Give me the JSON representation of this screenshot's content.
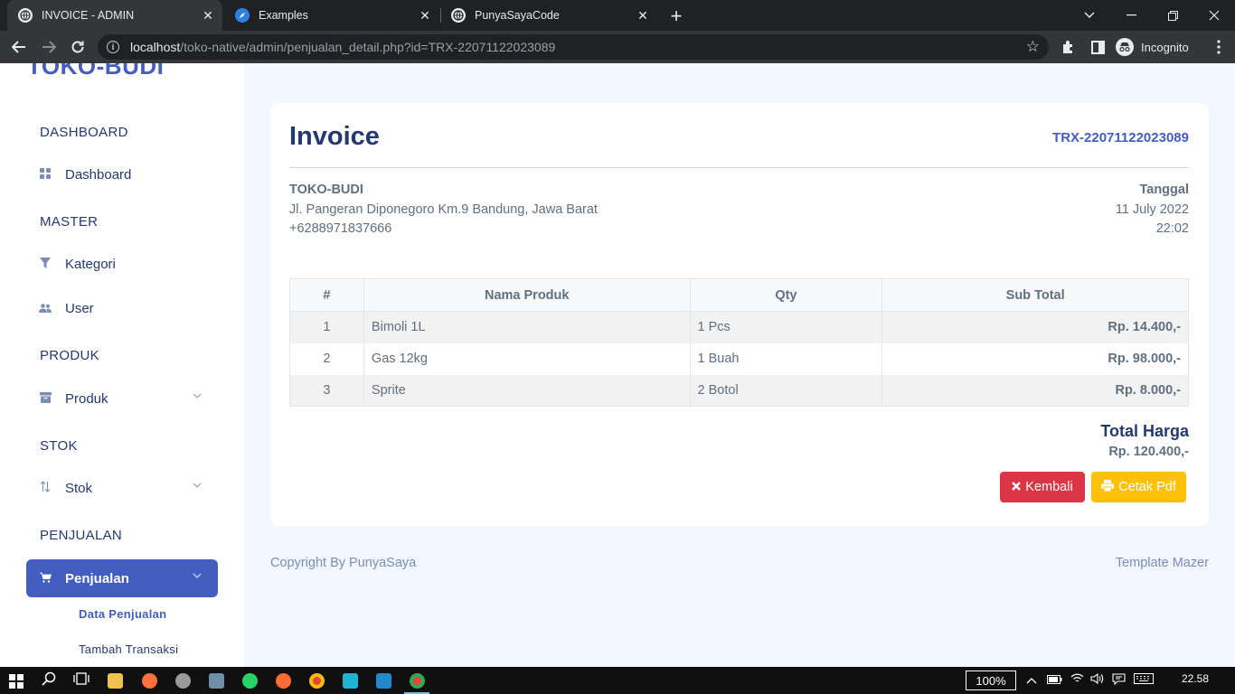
{
  "browser": {
    "tabs": [
      {
        "title": "INVOICE - ADMIN",
        "active": true
      },
      {
        "title": "Examples",
        "active": false
      },
      {
        "title": "PunyaSayaCode",
        "active": false
      }
    ],
    "url_host": "localhost",
    "url_path": "/toko-native/admin/penjualan_detail.php?id=TRX-22071122023089",
    "profile_label": "Incognito"
  },
  "sidebar": {
    "brand": "TOKO-BUDI",
    "sections": {
      "dashboard": "DASHBOARD",
      "master": "MASTER",
      "produk": "PRODUK",
      "stok": "STOK",
      "penjualan": "PENJUALAN"
    },
    "items": {
      "dashboard": "Dashboard",
      "kategori": "Kategori",
      "user": "User",
      "produk": "Produk",
      "stok": "Stok",
      "penjualan": "Penjualan"
    },
    "submenu": [
      "Data Penjualan",
      "Tambah Transaksi"
    ]
  },
  "invoice": {
    "title": "Invoice",
    "code": "TRX-22071122023089",
    "store_name": "TOKO-BUDI",
    "store_address": "Jl. Pangeran Diponegoro Km.9 Bandung, Jawa Barat",
    "store_phone": "+6288971837666",
    "date_label": "Tanggal",
    "date": "11 July 2022",
    "time": "22:02",
    "columns": [
      "#",
      "Nama Produk",
      "Qty",
      "Sub Total"
    ],
    "rows": [
      {
        "no": "1",
        "name": "Bimoli 1L",
        "qty": "1 Pcs",
        "subtotal": "Rp. 14.400,-"
      },
      {
        "no": "2",
        "name": "Gas 12kg",
        "qty": "1 Buah",
        "subtotal": "Rp. 98.000,-"
      },
      {
        "no": "3",
        "name": "Sprite",
        "qty": "2 Botol",
        "subtotal": "Rp. 8.000,-"
      }
    ],
    "total_label": "Total Harga",
    "total_value": "Rp. 120.400,-",
    "back_button": "Kembali",
    "pdf_button": "Cetak Pdf"
  },
  "footer": {
    "left": "Copyright By PunyaSaya",
    "right": "Template Mazer"
  },
  "taskbar": {
    "zoom": "100%",
    "time": "22.58"
  },
  "colors": {
    "primary": "#435ebe",
    "danger": "#dc3545",
    "warning": "#ffc107",
    "text_dark": "#25396f",
    "text_muted": "#607080",
    "page_bg": "#f2f7ff"
  }
}
